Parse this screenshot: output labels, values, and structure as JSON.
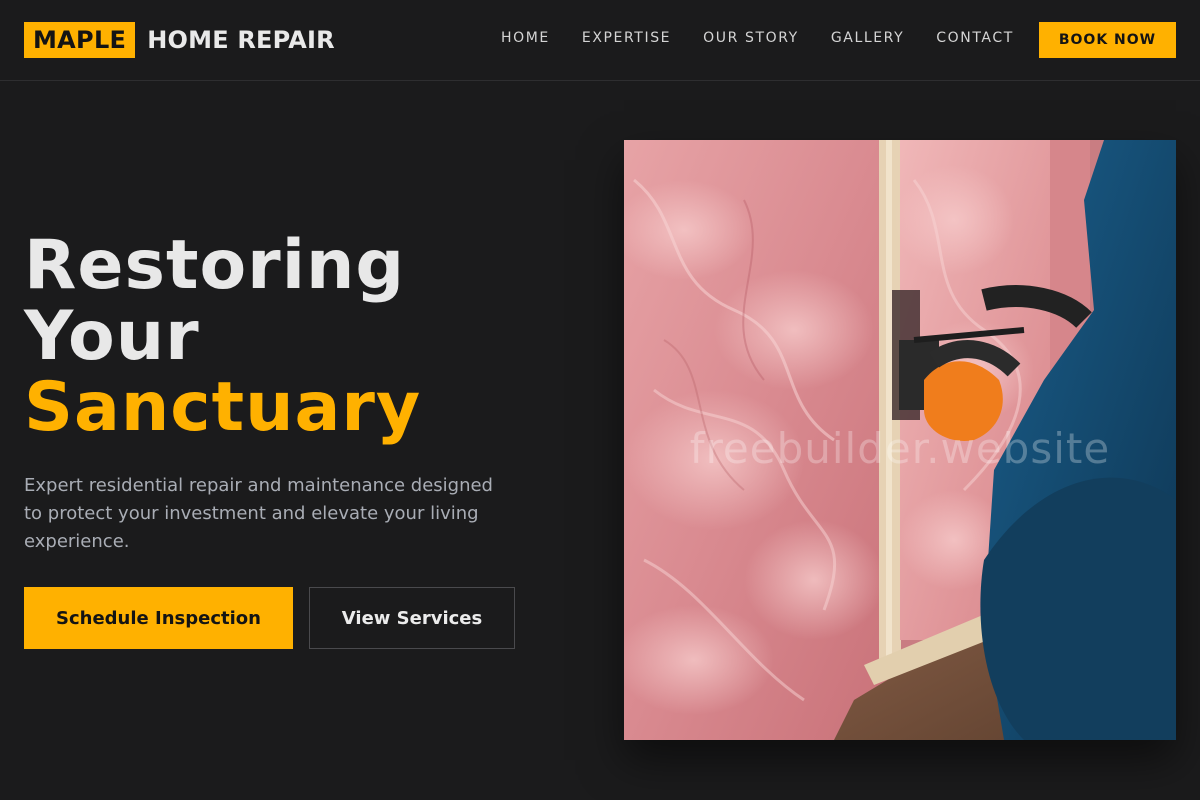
{
  "header": {
    "logo_mark": "MAPLE",
    "logo_text": "HOME REPAIR",
    "nav": [
      "HOME",
      "EXPERTISE",
      "OUR STORY",
      "GALLERY",
      "CONTACT"
    ],
    "cta_label": "BOOK NOW"
  },
  "hero": {
    "title_line1": "Restoring",
    "title_line2": "Your",
    "title_accent": "Sanctuary",
    "description": "Expert residential repair and maintenance designed to protect your investment and elevate your living experience.",
    "primary_button": "Schedule Inspection",
    "secondary_button": "View Services",
    "image_watermark": "freebuilder.website"
  },
  "colors": {
    "accent": "#ffb100",
    "background": "#1b1b1c",
    "text_muted": "#a9adb5"
  }
}
